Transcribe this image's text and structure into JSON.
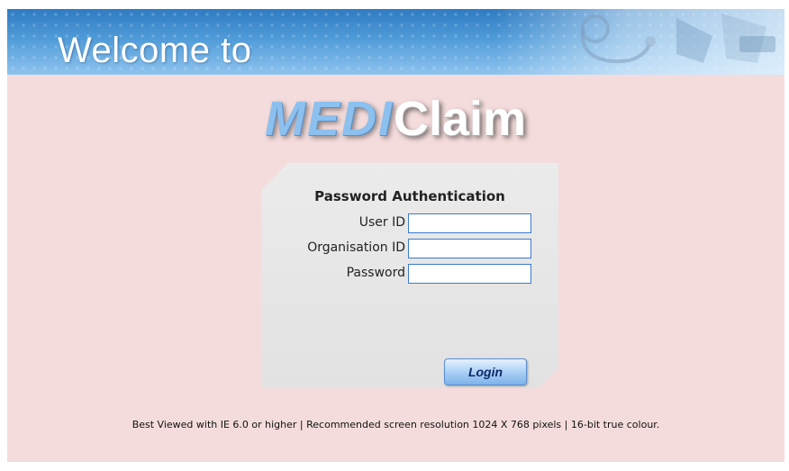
{
  "banner": {
    "welcome_text": "Welcome to"
  },
  "logo": {
    "part_a": "MEDI",
    "part_b": "Claim"
  },
  "login_form": {
    "title": "Password Authentication",
    "fields": [
      {
        "label": "User ID",
        "value": ""
      },
      {
        "label": "Organisation ID",
        "value": ""
      },
      {
        "label": "Password",
        "value": ""
      }
    ],
    "submit_label": "Login"
  },
  "footer": {
    "text": "Best Viewed with IE 6.0 or higher |  Recommended screen resolution 1024 X 768 pixels  |  16-bit true colour."
  },
  "colors": {
    "page_background": "#f5dcdc",
    "banner_blue": "#4f9bd8",
    "panel_grey": "#e6e6e6",
    "input_border": "#3b7ad0"
  }
}
